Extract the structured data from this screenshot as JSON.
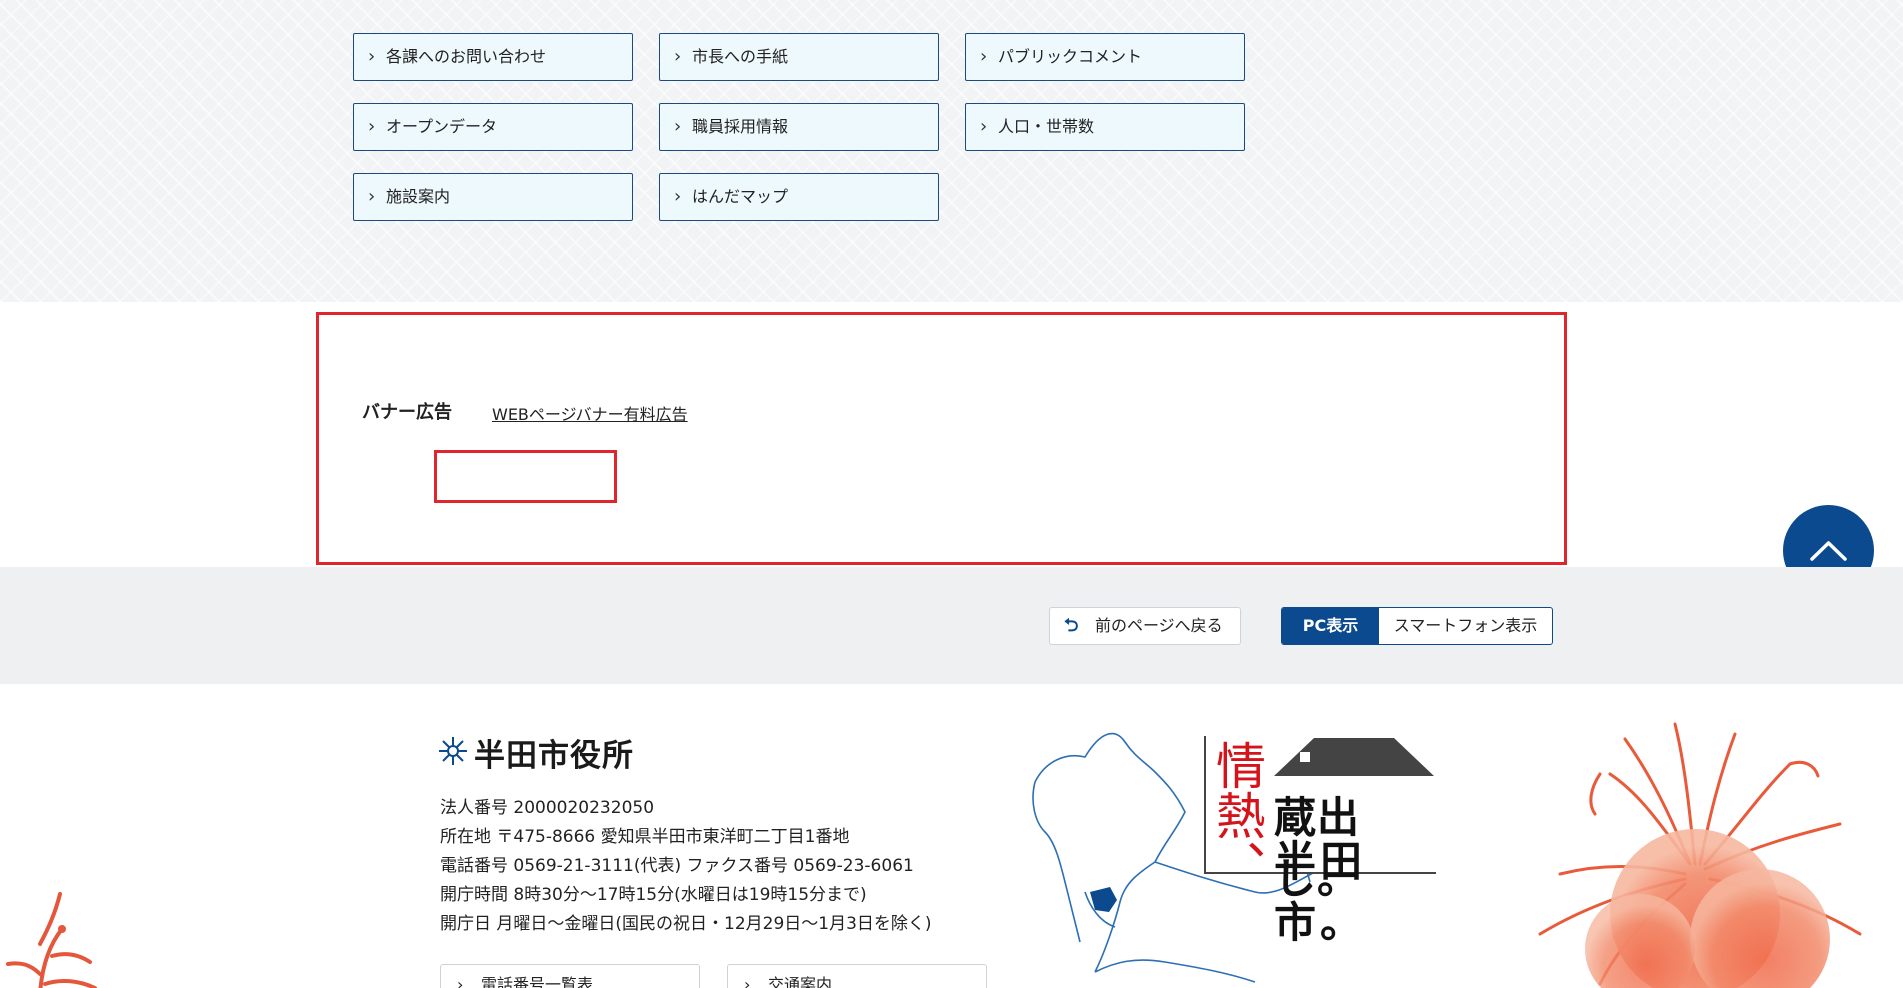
{
  "quick_links": [
    "各課へのお問い合わせ",
    "市長への手紙",
    "パブリックコメント",
    "オープンデータ",
    "職員採用情報",
    "人口・世帯数",
    "施設案内",
    "はんだマップ"
  ],
  "banner": {
    "title": "バナー広告",
    "link": "WEBページバナー有料広告"
  },
  "util": {
    "back": "前のページへ戻る",
    "pc": "PC表示",
    "smartphone": "スマートフォン表示"
  },
  "footer": {
    "office_name": "半田市役所",
    "lines": [
      "法人番号 2000020232050",
      "所在地  〒475-8666 愛知県半田市東洋町二丁目1番地",
      "電話番号  0569-21-3111(代表)  ファクス番号 0569-23-6061",
      "開庁時間  8時30分～17時15分(水曜日は19時15分まで)",
      "開庁日  月曜日～金曜日(国民の祝日・12月29日～1月3日を除く)"
    ],
    "buttons": [
      "電話番号一覧表",
      "交通案内"
    ],
    "slogan": {
      "red": "情熱、",
      "line1": "蔵出し。",
      "line2": "半田市。"
    }
  },
  "colors": {
    "navy": "#0b4a8e",
    "link_border": "#1a4a80",
    "link_bg": "#eef9fd",
    "highlight_red": "#e0262c",
    "slogan_red": "#d4141a"
  },
  "icons": {
    "link": "chevron-right-icon",
    "back": "return-arrow-icon",
    "to_top": "chevron-up-icon"
  }
}
